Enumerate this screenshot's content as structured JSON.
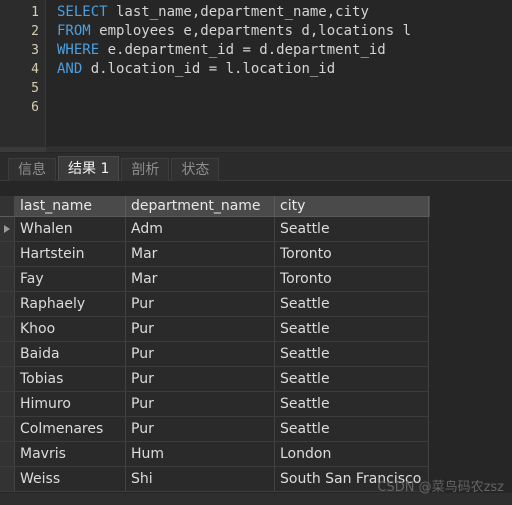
{
  "editor": {
    "line_numbers": [
      "1",
      "2",
      "3",
      "4",
      "5",
      "6"
    ],
    "lines": [
      {
        "keyword": "SELECT",
        "rest": " last_name,department_name,city"
      },
      {
        "keyword": "FROM",
        "rest": " employees e,departments d,locations l"
      },
      {
        "keyword": "WHERE",
        "rest": " e.department_id = d.department_id"
      },
      {
        "keyword": "AND",
        "rest": " d.location_id = l.location_id"
      },
      {
        "keyword": "",
        "rest": ""
      },
      {
        "keyword": "",
        "rest": ""
      }
    ]
  },
  "tabs": [
    {
      "label": "信息",
      "active": false
    },
    {
      "label": "结果 1",
      "active": true
    },
    {
      "label": "剖析",
      "active": false
    },
    {
      "label": "状态",
      "active": false
    }
  ],
  "result_grid": {
    "columns": [
      "last_name",
      "department_name",
      "city"
    ],
    "current_row_index": 0,
    "rows": [
      [
        "Whalen",
        "Adm",
        "Seattle"
      ],
      [
        "Hartstein",
        "Mar",
        "Toronto"
      ],
      [
        "Fay",
        "Mar",
        "Toronto"
      ],
      [
        "Raphaely",
        "Pur",
        "Seattle"
      ],
      [
        "Khoo",
        "Pur",
        "Seattle"
      ],
      [
        "Baida",
        "Pur",
        "Seattle"
      ],
      [
        "Tobias",
        "Pur",
        "Seattle"
      ],
      [
        "Himuro",
        "Pur",
        "Seattle"
      ],
      [
        "Colmenares",
        "Pur",
        "Seattle"
      ],
      [
        "Mavris",
        "Hum",
        "London"
      ],
      [
        "Weiss",
        "Shi",
        "South San Francisco"
      ]
    ]
  },
  "watermark": {
    "text": "CSDN @菜鸟码农zsz"
  },
  "colors": {
    "editor_bg": "#262626",
    "gutter_bg": "#2c2c2c",
    "keyword": "#4d9fdd",
    "code_text": "#d4d4d4",
    "line_number": "#d8cfae",
    "grid_header_bg": "#4a4a4a",
    "grid_row_bg": "#2a2a2a",
    "tab_active_bg": "#3b3b3b",
    "tab_inactive_bg": "#313131"
  }
}
